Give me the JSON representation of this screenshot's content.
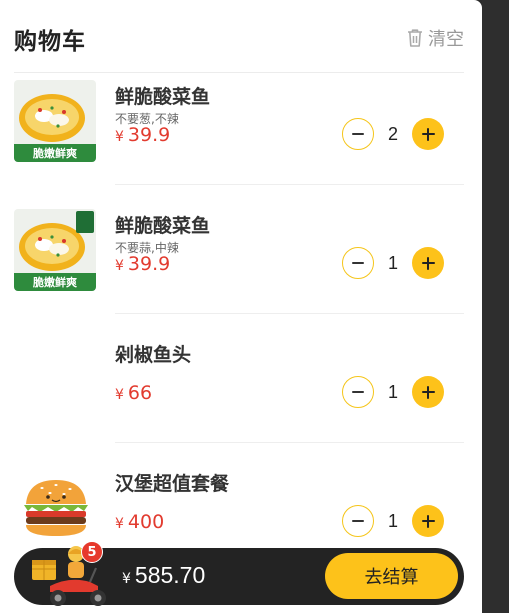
{
  "cart": {
    "title": "购物车",
    "clear_label": "清空",
    "items": [
      {
        "name": "鲜脆酸菜鱼",
        "spec": "不要葱,不辣",
        "currency": "¥",
        "price": "39.9",
        "qty": "2",
        "image": "sauerkraut-fish",
        "thumb_text": "脆嫩鲜爽"
      },
      {
        "name": "鲜脆酸菜鱼",
        "spec": "不要蒜,中辣",
        "currency": "¥",
        "price": "39.9",
        "qty": "1",
        "image": "sauerkraut-fish",
        "thumb_text": "脆嫩鲜爽"
      },
      {
        "name": "剁椒鱼头",
        "spec": "",
        "currency": "¥",
        "price": "66",
        "qty": "1",
        "image": ""
      },
      {
        "name": "汉堡超值套餐",
        "spec": "",
        "currency": "¥",
        "price": "400",
        "qty": "1",
        "image": ""
      }
    ]
  },
  "footer": {
    "badge_count": "5",
    "currency": "¥",
    "total": "585.70",
    "checkout_label": "去结算"
  },
  "colors": {
    "accent": "#fdc21a",
    "price": "#e23b2f",
    "bar": "#232323"
  },
  "icons": [
    "trash-icon",
    "minus-icon",
    "plus-icon",
    "courier-scooter-icon",
    "burger-mascot-icon"
  ]
}
